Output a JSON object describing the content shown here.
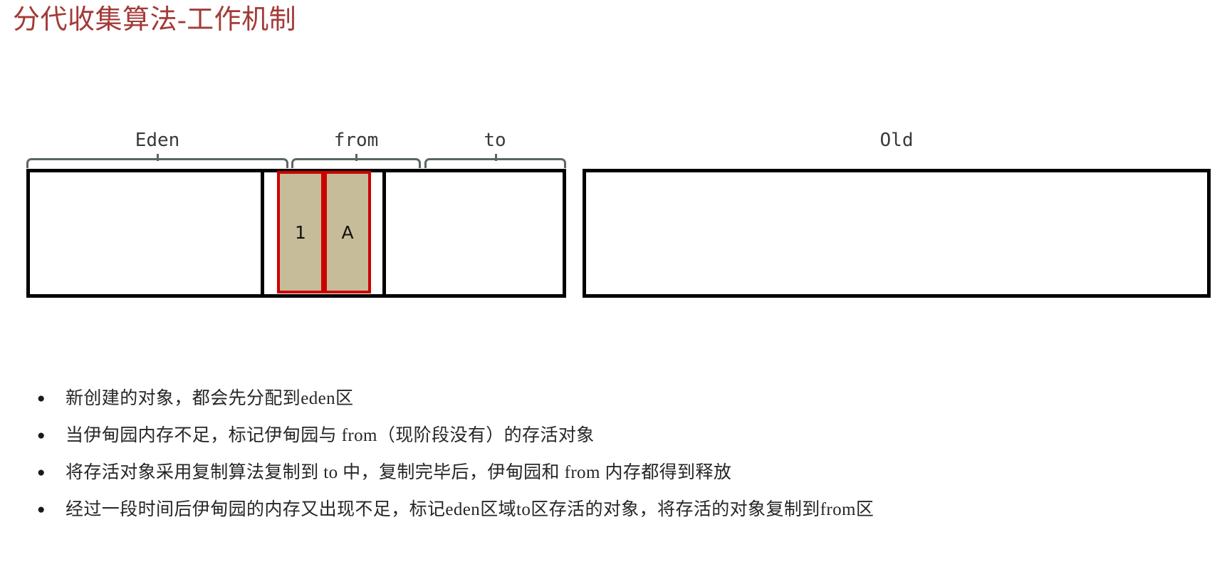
{
  "slide": {
    "title": "分代收集算法-工作机制",
    "title_color": "#a33b38"
  },
  "diagram": {
    "young_generation": {
      "regions": [
        {
          "key": "eden",
          "label": "Eden",
          "has_brace": true,
          "objects": []
        },
        {
          "key": "from",
          "label": "from",
          "has_brace": true,
          "objects": [
            {
              "label": "1"
            },
            {
              "label": "A"
            }
          ]
        },
        {
          "key": "to",
          "label": "to",
          "has_brace": true,
          "objects": []
        }
      ]
    },
    "old_generation": {
      "key": "old",
      "label": "Old",
      "has_brace": false,
      "objects": []
    },
    "colors": {
      "block_border": "#000000",
      "block_fill": "#ffffff",
      "brace": "#5b6566",
      "object_fill": "#c6bc99",
      "object_border": "#cc0000",
      "label_text": "#3a3a3a"
    }
  },
  "notes": {
    "bullet_marker": "●",
    "items": [
      "新创建的对象，都会先分配到eden区",
      "当伊甸园内存不足，标记伊甸园与 from（现阶段没有）的存活对象",
      "将存活对象采用复制算法复制到 to 中，复制完毕后，伊甸园和 from 内存都得到释放",
      "经过一段时间后伊甸园的内存又出现不足，标记eden区域to区存活的对象，将存活的对象复制到from区"
    ]
  }
}
